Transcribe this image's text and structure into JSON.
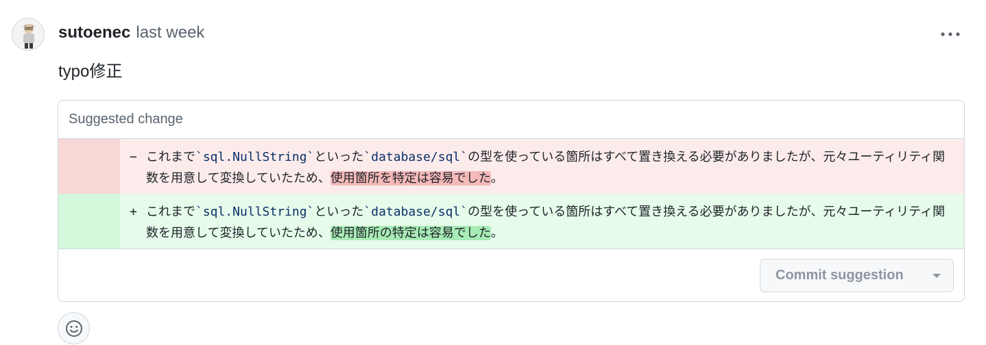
{
  "comment": {
    "author": "sutoenec",
    "time": "last week",
    "body": "typo修正"
  },
  "suggestion": {
    "header": "Suggested change",
    "deleted": {
      "sign": "−",
      "before_code1": "これまで",
      "code1": "`sql.NullString`",
      "between_codes": "といった",
      "code2": "`database/sql`",
      "after_code2": "の型を使っている箇所はすべて置き換える必要がありましたが、元々ユーティリティ関数を用意して変換していたため、",
      "highlight": "使用箇所を特定は容易でした",
      "tail": "。"
    },
    "added": {
      "sign": "+",
      "before_code1": "これまで",
      "code1": "`sql.NullString`",
      "between_codes": "といった",
      "code2": "`database/sql`",
      "after_code2": "の型を使っている箇所はすべて置き換える必要がありましたが、元々ユーティリティ関数を用意して変換していたため、",
      "highlight": "使用箇所の特定は容易でした",
      "tail": "。"
    },
    "commit_button": "Commit suggestion"
  },
  "icons": {
    "kebab": "kebab-horizontal-icon",
    "dropdown": "triangle-down-icon",
    "reaction": "smiley-icon"
  }
}
